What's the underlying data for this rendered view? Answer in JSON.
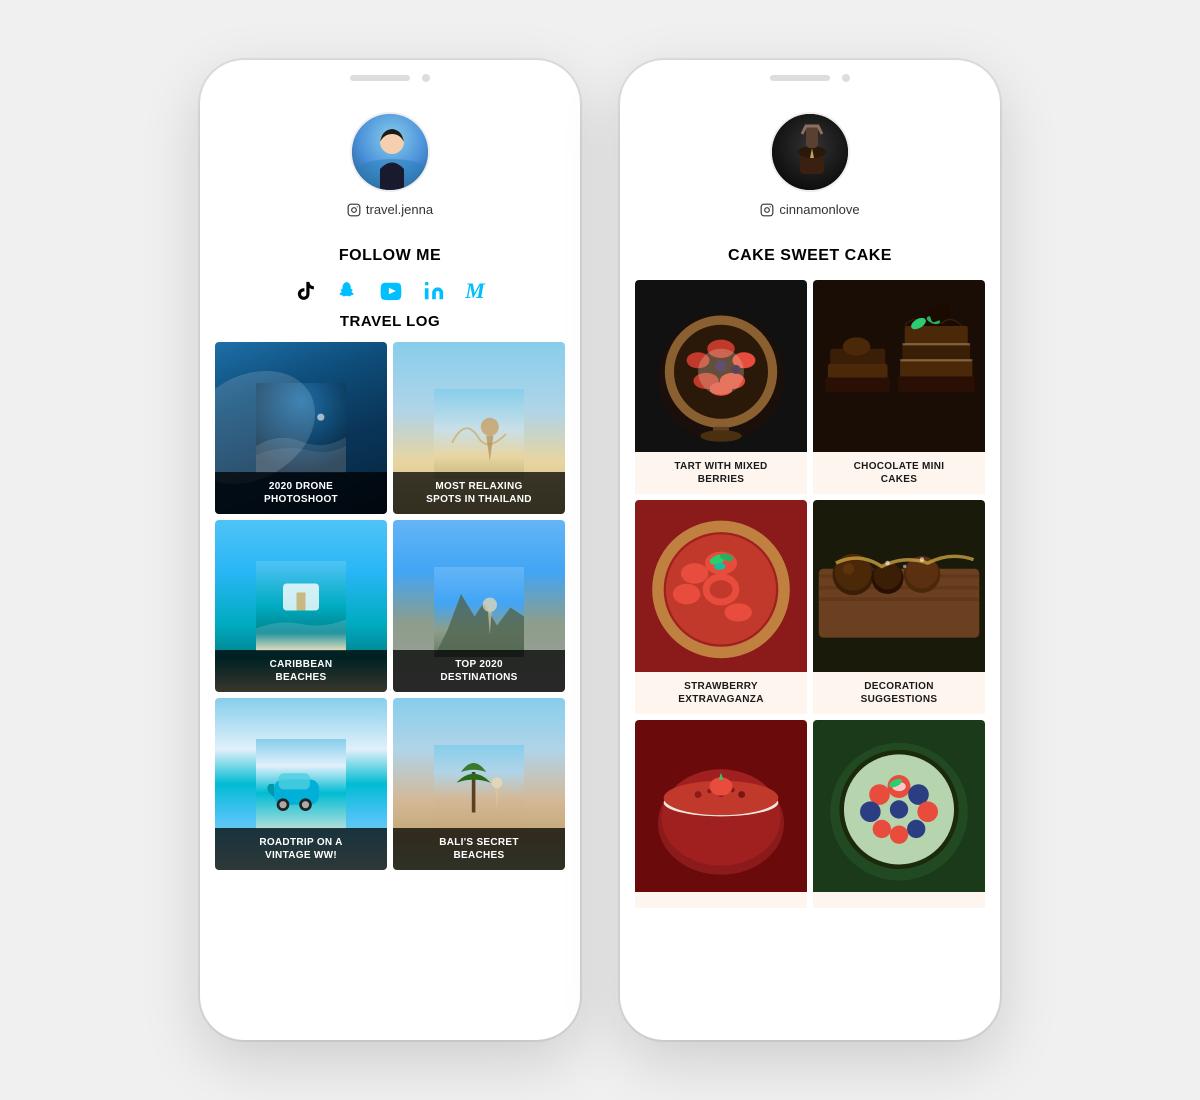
{
  "phone1": {
    "username": "travel.jenna",
    "followTitle": "FOLLOW ME",
    "travelLogTitle": "TRAVEL LOG",
    "socials": [
      {
        "name": "TikTok",
        "icon": "♪",
        "class": "tiktok"
      },
      {
        "name": "Snapchat",
        "icon": "👻",
        "class": "snapchat"
      },
      {
        "name": "YouTube",
        "icon": "▶",
        "class": "youtube"
      },
      {
        "name": "LinkedIn",
        "icon": "in",
        "class": "linkedin"
      },
      {
        "name": "Medium",
        "icon": "M",
        "class": "medium"
      }
    ],
    "posts": [
      {
        "caption": "2020 DRONE\nPHOTOSHOOT",
        "imgClass": "img-drone"
      },
      {
        "caption": "MOST RELAXING\nSPOTS IN THAILAND",
        "imgClass": "img-thailand"
      },
      {
        "caption": "CARIBBEAN\nBEACHES",
        "imgClass": "img-caribbean"
      },
      {
        "caption": "TOP 2020\nDESTINATIONS",
        "imgClass": "img-destinations"
      },
      {
        "caption": "ROADTRIP ON A\nVINTAGE WW!",
        "imgClass": "img-roadtrip"
      },
      {
        "caption": "BALI'S SECRET\nBEACHES",
        "imgClass": "img-bali"
      }
    ]
  },
  "phone2": {
    "username": "cinnamonlove",
    "blogTitle": "CAKE SWEET CAKE",
    "posts": [
      {
        "caption": "TART WITH MIXED\nBERRIES",
        "imgClass": "img-tart",
        "bgColor": "#fdf5ee"
      },
      {
        "caption": "CHOCOLATE MINI\nCAKES",
        "imgClass": "img-choco-cakes",
        "bgColor": "#fdf5ee"
      },
      {
        "caption": "STRAWBERRY\nEXTRAVAGANZA",
        "imgClass": "img-strawberry",
        "bgColor": "#fdf5ee"
      },
      {
        "caption": "DECORATION\nSUGGESTIONS",
        "imgClass": "img-decoration",
        "bgColor": "#fdf5ee"
      },
      {
        "caption": "",
        "imgClass": "img-red-cake",
        "bgColor": "#fdf5ee"
      },
      {
        "caption": "",
        "imgClass": "img-berry-tart",
        "bgColor": "#fdf5ee"
      }
    ]
  }
}
